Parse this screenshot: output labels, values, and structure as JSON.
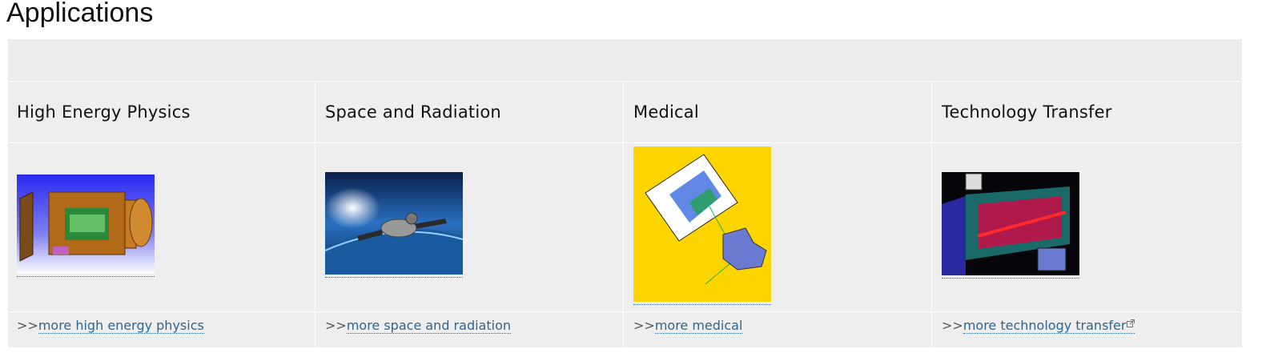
{
  "page": {
    "title": "Applications"
  },
  "columns": [
    {
      "title": "High Energy Physics",
      "prefix": ">>",
      "link": "more high energy physics",
      "image": "detector-illustration"
    },
    {
      "title": "Space and Radiation",
      "prefix": ">>",
      "link": "more space and radiation",
      "image": "satellite-over-earth"
    },
    {
      "title": "Medical",
      "prefix": ">>",
      "link": "more medical",
      "image": "medical-dose-plot"
    },
    {
      "title": "Technology Transfer",
      "prefix": ">>",
      "link": "more technology transfer",
      "image": "detector-cutaway",
      "external": true
    }
  ],
  "colors": {
    "panel": "#eeeeee",
    "link": "#2f6690",
    "medical_bg": "#ffd500"
  }
}
